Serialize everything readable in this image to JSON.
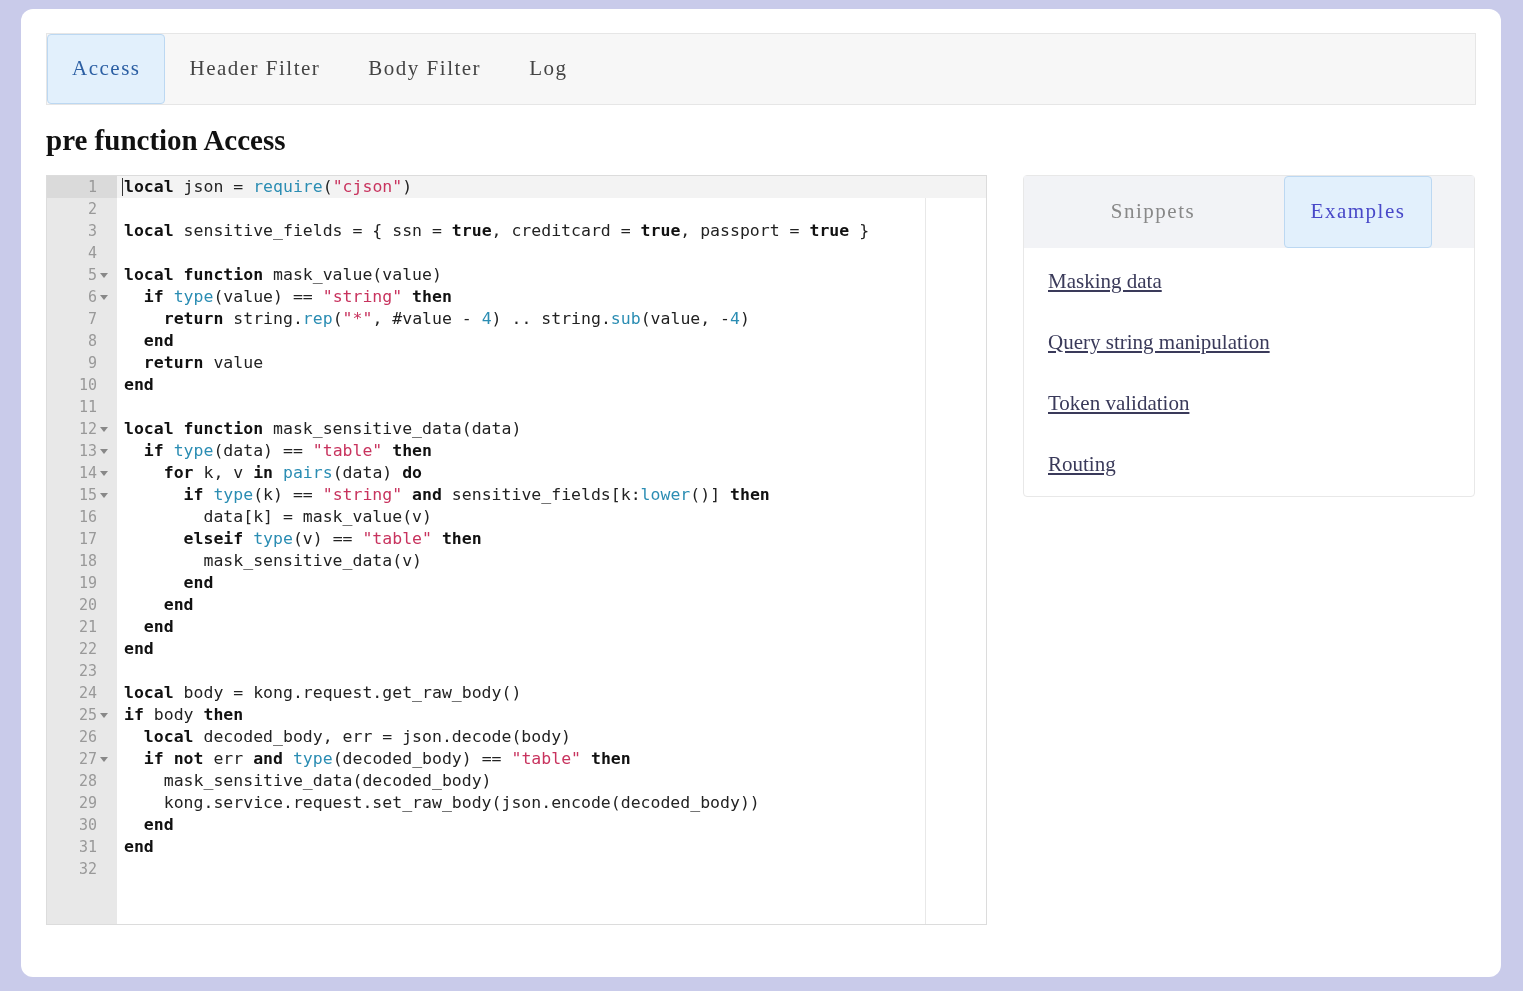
{
  "tabs": [
    {
      "label": "Access",
      "selected": true
    },
    {
      "label": "Header Filter",
      "selected": false
    },
    {
      "label": "Body Filter",
      "selected": false
    },
    {
      "label": "Log",
      "selected": false
    }
  ],
  "heading": "pre function Access",
  "editor": {
    "lines": [
      {
        "n": "1",
        "fold": false,
        "active": true,
        "tokens": [
          {
            "kind": "kw",
            "text": "local"
          },
          {
            "kind": "plain",
            "text": " json ="
          },
          {
            "kind": "fn",
            "text": " require"
          },
          {
            "kind": "plain",
            "text": "("
          },
          {
            "kind": "str",
            "text": "\"cjson\""
          },
          {
            "kind": "plain",
            "text": ")"
          }
        ]
      },
      {
        "n": "2",
        "fold": false,
        "active": false
      },
      {
        "n": "3",
        "fold": false,
        "active": false,
        "tokens": [
          {
            "kind": "kw",
            "text": "local"
          },
          {
            "kind": "plain",
            "text": " sensitive_fields = { ssn ="
          },
          {
            "kind": "kw",
            "text": " true"
          },
          {
            "kind": "plain",
            "text": ", creditcard ="
          },
          {
            "kind": "kw",
            "text": " true"
          },
          {
            "kind": "plain",
            "text": ", passport ="
          },
          {
            "kind": "kw",
            "text": " true"
          },
          {
            "kind": "plain",
            "text": " }"
          }
        ]
      },
      {
        "n": "4",
        "fold": false,
        "active": false
      },
      {
        "n": "5",
        "fold": true,
        "active": false,
        "tokens": [
          {
            "kind": "kw",
            "text": "local function"
          },
          {
            "kind": "plain",
            "text": " mask_value(value)"
          }
        ]
      },
      {
        "n": "6",
        "fold": true,
        "active": false,
        "tokens": [
          {
            "kind": "kw",
            "text": "  if"
          },
          {
            "kind": "fn",
            "text": " type"
          },
          {
            "kind": "plain",
            "text": "(value) =="
          },
          {
            "kind": "str",
            "text": " \"string\""
          },
          {
            "kind": "kw",
            "text": " then"
          }
        ]
      },
      {
        "n": "7",
        "fold": false,
        "active": false,
        "tokens": [
          {
            "kind": "kw",
            "text": "    return"
          },
          {
            "kind": "plain",
            "text": " string."
          },
          {
            "kind": "fn",
            "text": "rep"
          },
          {
            "kind": "plain",
            "text": "("
          },
          {
            "kind": "str",
            "text": "\"*\""
          },
          {
            "kind": "plain",
            "text": ", #value -"
          },
          {
            "kind": "num",
            "text": " 4"
          },
          {
            "kind": "plain",
            "text": ") .. string."
          },
          {
            "kind": "fn",
            "text": "sub"
          },
          {
            "kind": "plain",
            "text": "(value, -"
          },
          {
            "kind": "num",
            "text": "4"
          },
          {
            "kind": "plain",
            "text": ")"
          }
        ]
      },
      {
        "n": "8",
        "fold": false,
        "active": false,
        "tokens": [
          {
            "kind": "kw",
            "text": "  end"
          }
        ]
      },
      {
        "n": "9",
        "fold": false,
        "active": false,
        "tokens": [
          {
            "kind": "kw",
            "text": "  return"
          },
          {
            "kind": "plain",
            "text": " value"
          }
        ]
      },
      {
        "n": "10",
        "fold": false,
        "active": false,
        "tokens": [
          {
            "kind": "kw",
            "text": "end"
          }
        ]
      },
      {
        "n": "11",
        "fold": false,
        "active": false
      },
      {
        "n": "12",
        "fold": true,
        "active": false,
        "tokens": [
          {
            "kind": "kw",
            "text": "local function"
          },
          {
            "kind": "plain",
            "text": " mask_sensitive_data(data)"
          }
        ]
      },
      {
        "n": "13",
        "fold": true,
        "active": false,
        "tokens": [
          {
            "kind": "kw",
            "text": "  if"
          },
          {
            "kind": "fn",
            "text": " type"
          },
          {
            "kind": "plain",
            "text": "(data) =="
          },
          {
            "kind": "str",
            "text": " \"table\""
          },
          {
            "kind": "kw",
            "text": " then"
          }
        ]
      },
      {
        "n": "14",
        "fold": true,
        "active": false,
        "tokens": [
          {
            "kind": "kw",
            "text": "    for"
          },
          {
            "kind": "plain",
            "text": " k, v"
          },
          {
            "kind": "kw",
            "text": " in"
          },
          {
            "kind": "fn",
            "text": " pairs"
          },
          {
            "kind": "plain",
            "text": "(data)"
          },
          {
            "kind": "kw",
            "text": " do"
          }
        ]
      },
      {
        "n": "15",
        "fold": true,
        "active": false,
        "tokens": [
          {
            "kind": "kw",
            "text": "      if"
          },
          {
            "kind": "fn",
            "text": " type"
          },
          {
            "kind": "plain",
            "text": "(k) =="
          },
          {
            "kind": "str",
            "text": " \"string\""
          },
          {
            "kind": "kw",
            "text": " and"
          },
          {
            "kind": "plain",
            "text": " sensitive_fields[k:"
          },
          {
            "kind": "fn",
            "text": "lower"
          },
          {
            "kind": "plain",
            "text": "()]"
          },
          {
            "kind": "kw",
            "text": " then"
          }
        ]
      },
      {
        "n": "16",
        "fold": false,
        "active": false,
        "tokens": [
          {
            "kind": "plain",
            "text": "        data[k] = mask_value(v)"
          }
        ]
      },
      {
        "n": "17",
        "fold": false,
        "active": false,
        "tokens": [
          {
            "kind": "kw",
            "text": "      elseif"
          },
          {
            "kind": "fn",
            "text": " type"
          },
          {
            "kind": "plain",
            "text": "(v) =="
          },
          {
            "kind": "str",
            "text": " \"table\""
          },
          {
            "kind": "kw",
            "text": " then"
          }
        ]
      },
      {
        "n": "18",
        "fold": false,
        "active": false,
        "tokens": [
          {
            "kind": "plain",
            "text": "        mask_sensitive_data(v)"
          }
        ]
      },
      {
        "n": "19",
        "fold": false,
        "active": false,
        "tokens": [
          {
            "kind": "kw",
            "text": "      end"
          }
        ]
      },
      {
        "n": "20",
        "fold": false,
        "active": false,
        "tokens": [
          {
            "kind": "kw",
            "text": "    end"
          }
        ]
      },
      {
        "n": "21",
        "fold": false,
        "active": false,
        "tokens": [
          {
            "kind": "kw",
            "text": "  end"
          }
        ]
      },
      {
        "n": "22",
        "fold": false,
        "active": false,
        "tokens": [
          {
            "kind": "kw",
            "text": "end"
          }
        ]
      },
      {
        "n": "23",
        "fold": false,
        "active": false
      },
      {
        "n": "24",
        "fold": false,
        "active": false,
        "tokens": [
          {
            "kind": "kw",
            "text": "local"
          },
          {
            "kind": "plain",
            "text": " body = kong.request.get_raw_body()"
          }
        ]
      },
      {
        "n": "25",
        "fold": true,
        "active": false,
        "tokens": [
          {
            "kind": "kw",
            "text": "if"
          },
          {
            "kind": "plain",
            "text": " body"
          },
          {
            "kind": "kw",
            "text": " then"
          }
        ]
      },
      {
        "n": "26",
        "fold": false,
        "active": false,
        "tokens": [
          {
            "kind": "kw",
            "text": "  local"
          },
          {
            "kind": "plain",
            "text": " decoded_body, err = json.decode(body)"
          }
        ]
      },
      {
        "n": "27",
        "fold": true,
        "active": false,
        "tokens": [
          {
            "kind": "kw",
            "text": "  if not"
          },
          {
            "kind": "plain",
            "text": " err"
          },
          {
            "kind": "kw",
            "text": " and"
          },
          {
            "kind": "fn",
            "text": " type"
          },
          {
            "kind": "plain",
            "text": "(decoded_body) =="
          },
          {
            "kind": "str",
            "text": " \"table\""
          },
          {
            "kind": "kw",
            "text": " then"
          }
        ]
      },
      {
        "n": "28",
        "fold": false,
        "active": false,
        "tokens": [
          {
            "kind": "plain",
            "text": "    mask_sensitive_data(decoded_body)"
          }
        ]
      },
      {
        "n": "29",
        "fold": false,
        "active": false,
        "tokens": [
          {
            "kind": "plain",
            "text": "    kong.service.request.set_raw_body(json.encode(decoded_body))"
          }
        ]
      },
      {
        "n": "30",
        "fold": false,
        "active": false,
        "tokens": [
          {
            "kind": "kw",
            "text": "  end"
          }
        ]
      },
      {
        "n": "31",
        "fold": false,
        "active": false,
        "tokens": [
          {
            "kind": "kw",
            "text": "end"
          }
        ]
      },
      {
        "n": "32",
        "fold": false,
        "active": false
      }
    ]
  },
  "side_panel": {
    "tabs": [
      {
        "label": "Snippets",
        "selected": false
      },
      {
        "label": "Examples",
        "selected": true
      }
    ],
    "links": [
      "Masking data",
      "Query string manipulation",
      "Token validation",
      "Routing"
    ]
  }
}
